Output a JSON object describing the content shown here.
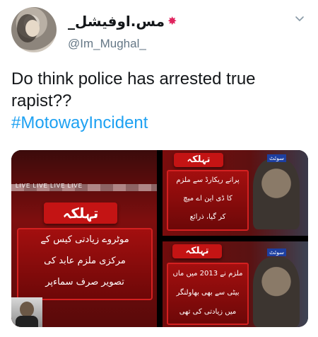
{
  "tweet": {
    "display_name": "مس.اوفیشل_",
    "name_emoji_icon": "spark-burst-icon",
    "handle": "@Im_Mughal_",
    "text": "Do think police has arrested true rapist??",
    "hashtag": "#MotowayIncident"
  },
  "media": {
    "image1": {
      "banner": "تہلکہ",
      "caption_lines": [
        "موٹروے زیادتی کیس کے",
        "مرکزی ملزم عابد کی",
        "تصویر صرف سماءپر"
      ],
      "ticker": "LIVE LIVE LIVE LIVE"
    },
    "image2": {
      "banner": "تہلکہ",
      "caption_lines": [
        "پرانے ریکارڈ سے ملزم",
        "کا ڈی این اے میچ",
        "کر گیا، ذرائع"
      ],
      "logo": "سوئٹ"
    },
    "image3": {
      "banner": "تہلکہ",
      "caption_lines": [
        "ملزم نے 2013 میں ماں",
        "بیٹی سے بھی بھاولنگر",
        "میں زیادتی کی تھی"
      ],
      "logo": "سوئٹ"
    }
  },
  "colors": {
    "hashtag": "#1da1f2",
    "text": "#14171a",
    "muted": "#657786",
    "banner_red": "#c41414"
  }
}
